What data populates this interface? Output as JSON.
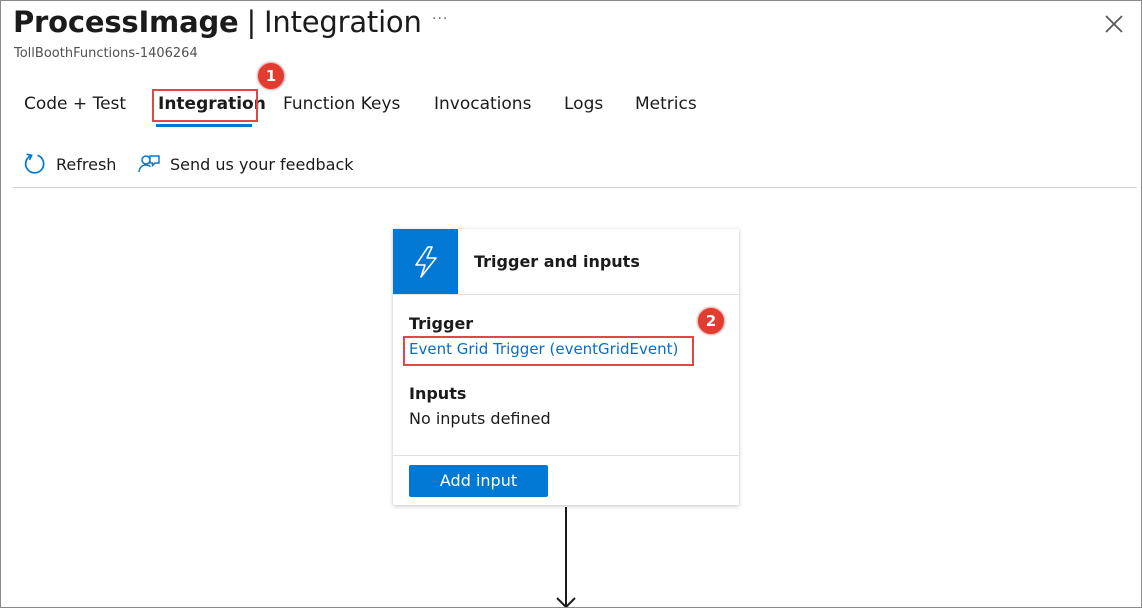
{
  "header": {
    "title_main": "ProcessImage",
    "title_sep": "|",
    "title_sub": "Integration",
    "more_label": "···",
    "subtitle": "TollBoothFunctions-1406264"
  },
  "tabs": [
    {
      "label": "Code + Test"
    },
    {
      "label": "Integration",
      "active": true
    },
    {
      "label": "Function Keys"
    },
    {
      "label": "Invocations"
    },
    {
      "label": "Logs"
    },
    {
      "label": "Metrics"
    }
  ],
  "commands": {
    "refresh_label": "Refresh",
    "feedback_label": "Send us your feedback"
  },
  "annotations": {
    "badge1": "1",
    "badge2": "2"
  },
  "card": {
    "title": "Trigger and inputs",
    "trigger_heading": "Trigger",
    "trigger_link": "Event Grid Trigger (eventGridEvent)",
    "inputs_heading": "Inputs",
    "inputs_empty": "No inputs defined",
    "add_input_label": "Add input"
  },
  "colors": {
    "accent": "#0078d4",
    "link": "#0a6cc7",
    "highlight": "#e04848",
    "badge": "#e23b30"
  },
  "icons": {
    "close": "close-icon",
    "refresh": "refresh-icon",
    "feedback": "feedback-icon",
    "trigger": "lightning-icon",
    "flow": "arrow-down-icon"
  }
}
